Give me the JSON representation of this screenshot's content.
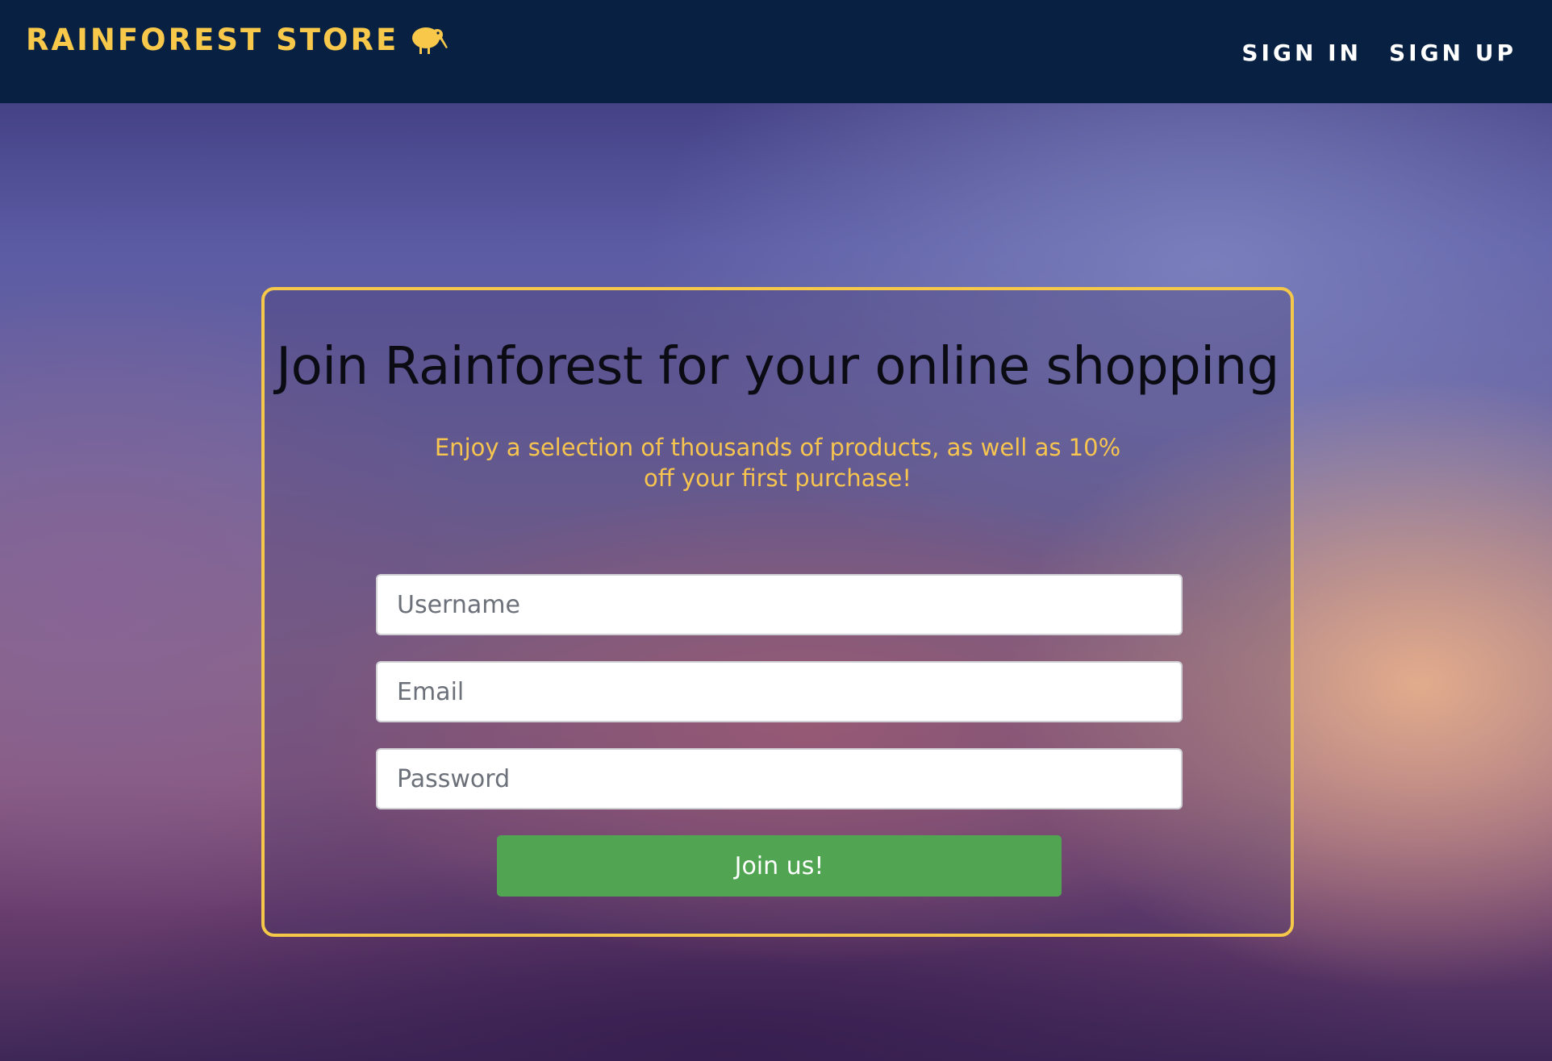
{
  "navbar": {
    "brand": "RAINFOREST STORE",
    "brand_icon": "kiwi-bird-icon",
    "sign_in_label": "SIGN IN",
    "sign_up_label": "SIGN UP",
    "accent_color": "#f7c84a",
    "background_color": "#082143"
  },
  "signup_card": {
    "title": "Join Rainforest for your online shopping",
    "subtitle": "Enjoy a selection of thousands of products, as well as 10% off your first purchase!",
    "username_placeholder": "Username",
    "email_placeholder": "Email",
    "password_placeholder": "Password",
    "submit_label": "Join us!",
    "border_color": "#f5c84a",
    "button_color": "#51a552"
  }
}
